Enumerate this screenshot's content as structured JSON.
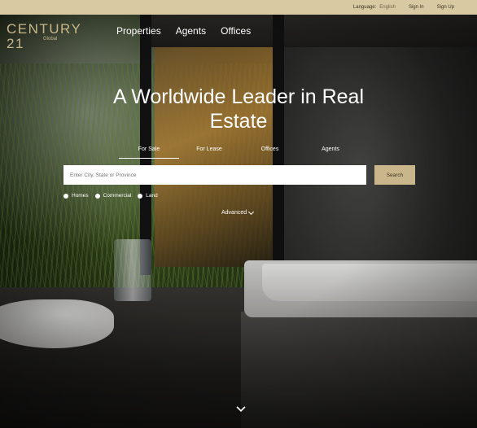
{
  "topbar": {
    "language_label": "Language:",
    "language_value": "English",
    "sign_in": "Sign In",
    "sign_up": "Sign Up"
  },
  "nav": {
    "brand": "CENTURY 21",
    "brand_sub": "Global",
    "links": [
      "Properties",
      "Agents",
      "Offices"
    ]
  },
  "hero": {
    "headline_line1": "A Worldwide Leader in Real",
    "headline_line2": "Estate",
    "tabs": [
      "For Sale",
      "For Lease",
      "Offices",
      "Agents"
    ],
    "active_tab": "For Sale",
    "search_placeholder": "Enter City, State or Province",
    "search_button": "Search",
    "property_types": [
      "Homes",
      "Commercial",
      "Land"
    ],
    "advanced_label": "Advanced"
  },
  "colors": {
    "gold": "#c9b68a",
    "topbar": "#d8c9a3",
    "text_light": "#ffffff"
  },
  "icons": {
    "scroll": "chevron-down-icon",
    "advanced": "chevron-down-icon"
  }
}
